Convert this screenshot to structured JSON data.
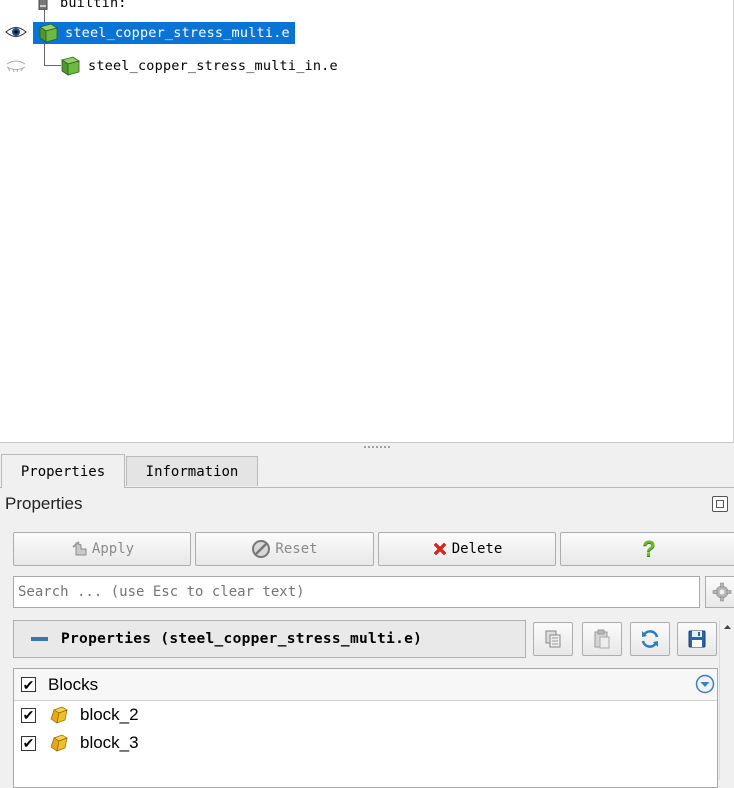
{
  "pipeline": {
    "root_label": "builtin:",
    "items": [
      {
        "label": "steel_copper_stress_multi.e",
        "visible": true,
        "selected": true
      },
      {
        "label": "steel_copper_stress_multi_in.e",
        "visible": false,
        "selected": false
      }
    ]
  },
  "tabs": [
    {
      "label": "Properties",
      "active": true
    },
    {
      "label": "Information",
      "active": false
    }
  ],
  "panel_title": "Properties",
  "buttons": {
    "apply": "Apply",
    "reset": "Reset",
    "delete": "Delete",
    "help": "?"
  },
  "search": {
    "placeholder": "Search ... (use Esc to clear text)"
  },
  "properties_header": "Properties (steel_copper_stress_multi.e)",
  "blocks": {
    "header": "Blocks",
    "header_checked": true,
    "items": [
      {
        "label": "block_2",
        "checked": true
      },
      {
        "label": "block_3",
        "checked": true
      }
    ]
  },
  "colors": {
    "selection": "#0a74d6",
    "delete_icon": "#e2211c",
    "help_icon": "#6bb52f",
    "collapse_bar": "#3278b5"
  }
}
